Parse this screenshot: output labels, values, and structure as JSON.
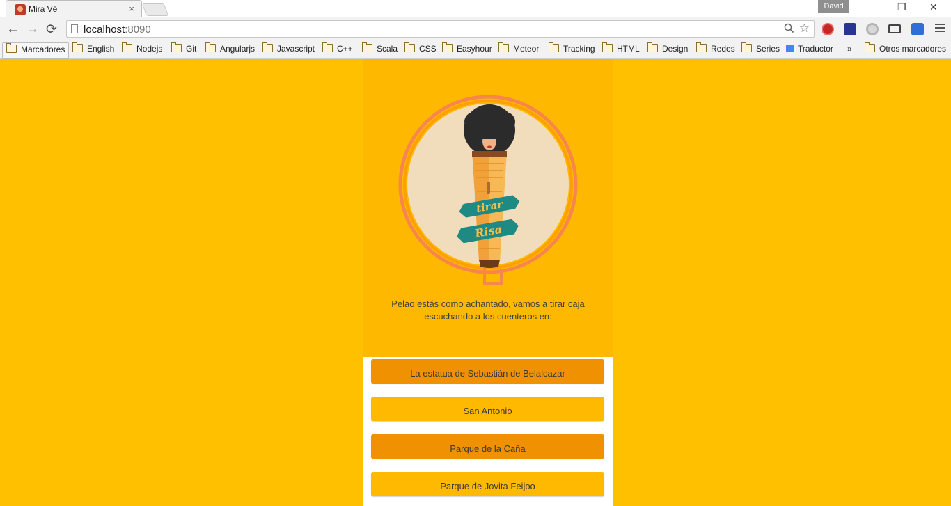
{
  "browser": {
    "tab_title": "Mira Vé",
    "tab_close": "×",
    "profile_name": "David",
    "window_controls": {
      "minimize": "—",
      "restore": "❐",
      "close": "✕"
    },
    "nav": {
      "back": "←",
      "forward": "→",
      "reload": "⟳"
    },
    "url_host": "localhost",
    "url_port": ":8090",
    "zoom_icon": "magnifier-icon",
    "star_icon": "☆",
    "extensions": [
      "ext-red-icon",
      "ext-dark-icon",
      "ext-grey-icon",
      "cast-icon",
      "ext-blue-icon"
    ]
  },
  "bookmarks": {
    "items": [
      "Marcadores",
      "English",
      "Nodejs",
      "Git",
      "Angularjs",
      "Javascript",
      "C++",
      "Scala",
      "CSS",
      "Easyhour",
      "Meteor",
      "Tracking",
      "HTML",
      "Design",
      "Redes",
      "Series",
      "Traductor"
    ],
    "overflow": "»",
    "other": "Otros marcadores"
  },
  "app": {
    "logo_text_top": "tirar",
    "logo_text_bottom": "Risa",
    "description": "Pelao estás como achantado, vamos a tirar caja escuchando a los cuenteros en:",
    "places": [
      {
        "label": "La estatua de Sebastián de Belalcazar",
        "style": "dark"
      },
      {
        "label": "San Antonio",
        "style": "light"
      },
      {
        "label": "Parque de la Caña",
        "style": "dark"
      },
      {
        "label": "Parque de Jovita Feijoo",
        "style": "light"
      }
    ]
  },
  "colors": {
    "page_bg": "#ffc000",
    "panel_bg": "#ffb800",
    "button_dark": "#ef9100",
    "button_light": "#ffba00",
    "ring": "#f7864a",
    "banner": "#1f8a84"
  }
}
